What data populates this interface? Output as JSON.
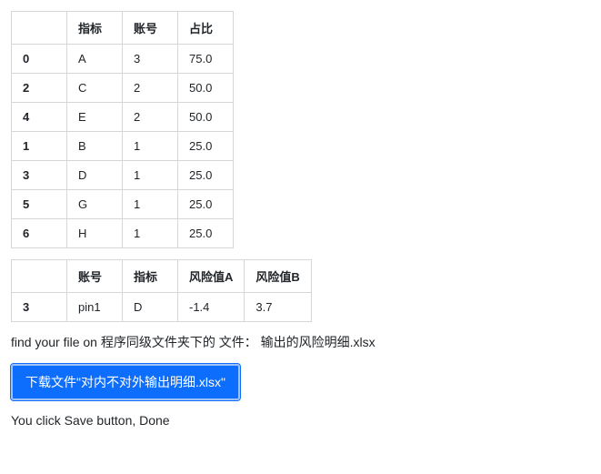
{
  "table1": {
    "columns": [
      "指标",
      "账号",
      "占比"
    ],
    "rows": [
      {
        "idx": "0",
        "c0": "A",
        "c1": "3",
        "c2": "75.0"
      },
      {
        "idx": "2",
        "c0": "C",
        "c1": "2",
        "c2": "50.0"
      },
      {
        "idx": "4",
        "c0": "E",
        "c1": "2",
        "c2": "50.0"
      },
      {
        "idx": "1",
        "c0": "B",
        "c1": "1",
        "c2": "25.0"
      },
      {
        "idx": "3",
        "c0": "D",
        "c1": "1",
        "c2": "25.0"
      },
      {
        "idx": "5",
        "c0": "G",
        "c1": "1",
        "c2": "25.0"
      },
      {
        "idx": "6",
        "c0": "H",
        "c1": "1",
        "c2": "25.0"
      }
    ]
  },
  "table2": {
    "columns": [
      "账号",
      "指标",
      "风险值A",
      "风险值B"
    ],
    "rows": [
      {
        "idx": "3",
        "c0": "pin1",
        "c1": "D",
        "c2": "-1.4",
        "c3": "3.7"
      }
    ]
  },
  "messages": {
    "file_location": "find your file on 程序同级文件夹下的 文件：  输出的风险明细.xlsx",
    "download_button": "下载文件\"对内不对外输出明细.xlsx\"",
    "done": "You click Save button, Done"
  }
}
